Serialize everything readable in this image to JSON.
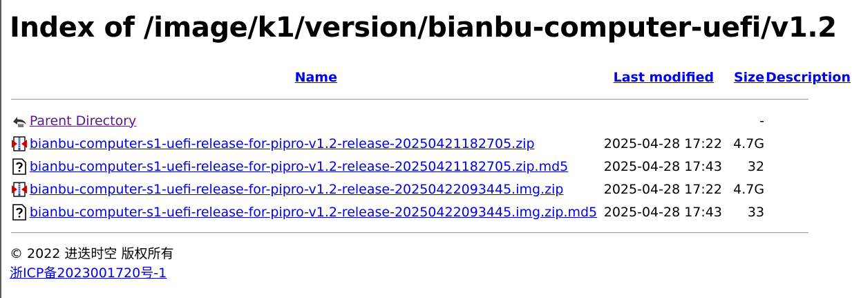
{
  "page": {
    "title": "Index of /image/k1/version/bianbu-computer-uefi/v1.2"
  },
  "table": {
    "headers": {
      "name": "Name",
      "last_modified": "Last modified",
      "size": "Size",
      "description": "Description"
    },
    "parent": {
      "icon": "back-icon",
      "name": "Parent Directory",
      "last_modified": "",
      "size": "-",
      "description": ""
    },
    "rows": [
      {
        "icon": "zip-archive-icon",
        "name": "bianbu-computer-s1-uefi-release-for-pipro-v1.2-release-20250421182705.zip",
        "last_modified": "2025-04-28 17:22",
        "size": "4.7G",
        "description": ""
      },
      {
        "icon": "unknown-file-icon",
        "name": "bianbu-computer-s1-uefi-release-for-pipro-v1.2-release-20250421182705.zip.md5",
        "last_modified": "2025-04-28 17:43",
        "size": "32",
        "description": ""
      },
      {
        "icon": "zip-archive-icon",
        "name": "bianbu-computer-s1-uefi-release-for-pipro-v1.2-release-20250422093445.img.zip",
        "last_modified": "2025-04-28 17:22",
        "size": "4.7G",
        "description": ""
      },
      {
        "icon": "unknown-file-icon",
        "name": "bianbu-computer-s1-uefi-release-for-pipro-v1.2-release-20250422093445.img.zip.md5",
        "last_modified": "2025-04-28 17:43",
        "size": "33",
        "description": ""
      }
    ]
  },
  "footer": {
    "copyright": "© 2022 进迭时空 版权所有",
    "icp_link": "浙ICP备2023001720号-1"
  },
  "colors": {
    "link": "#0000ee",
    "visited_link": "#551a8b",
    "rule": "#9a9a9a"
  }
}
